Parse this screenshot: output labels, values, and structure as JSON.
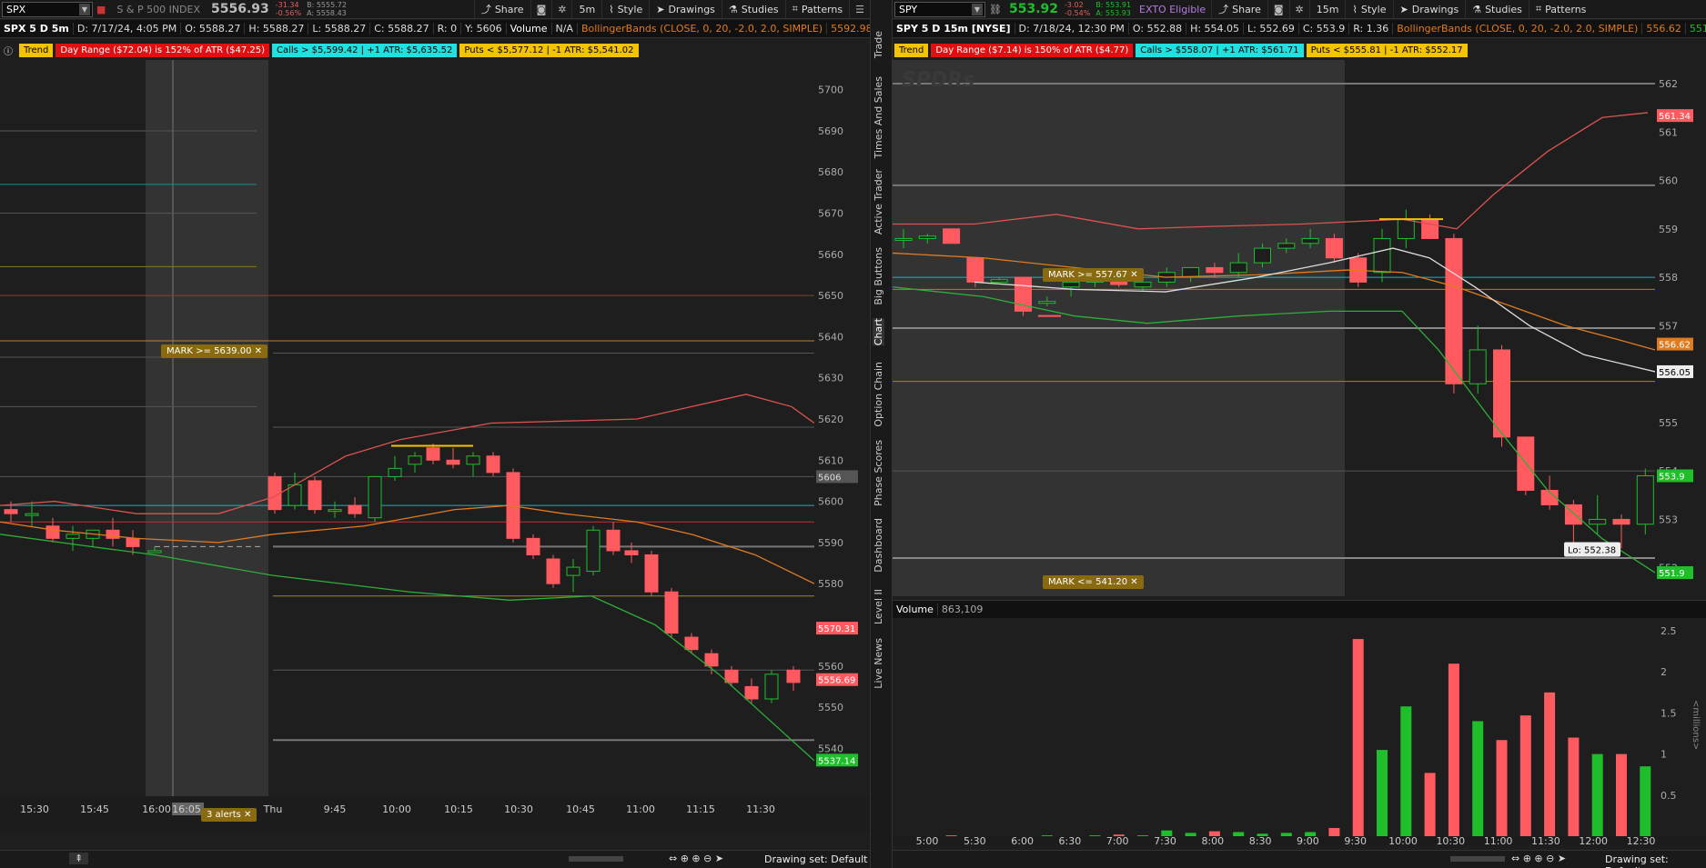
{
  "left": {
    "symbol": "SPX",
    "description": "S & P 500 INDEX",
    "price": "5556.93",
    "change": "-31.34",
    "change_pct": "-0.56%",
    "bid": "B: 5555.72",
    "ask": "A: 5558.43",
    "share_label": "Share",
    "timeframe": "5m",
    "style_label": "Style",
    "drawings_label": "Drawings",
    "studies_label": "Studies",
    "patterns_label": "Patterns",
    "chart_title": "SPX 5 D 5m",
    "info": [
      "D: 7/17/24, 4:05 PM",
      "O: 5588.27",
      "H: 5588.27",
      "L: 5588.27",
      "C: 5588.27",
      "R: 0",
      "Y: 5606"
    ],
    "volume_label": "Volume",
    "volume_value": "N/A",
    "bollinger": "BollingerBands (CLOSE, 0, 20, -2.0, 2.0, SIMPLE)",
    "bollinger_value": "5592.98",
    "chip_trend": "Trend",
    "chip_range": "Day Range ($72.04) is 152% of ATR ($47.25)",
    "chip_calls": "Calls > $5,599.42 | +1 ATR: $5,635.52",
    "chip_puts": "Puts < $5,577.12 | -1 ATR: $5,541.02",
    "mark_label": "MARK >= 5639.00",
    "alerts_label": "3 alerts",
    "price_labels": [
      "5700",
      "5690",
      "5680",
      "5670",
      "5660",
      "5650",
      "5640",
      "5630",
      "5620",
      "5610",
      "5600",
      "5590",
      "5580",
      "5560",
      "5550",
      "5540"
    ],
    "tag_5606": "5606",
    "tag_upper": "5570.31",
    "tag_price": "5556.69",
    "tag_lower": "5537.14",
    "time_labels": [
      "15:30",
      "15:45",
      "16:00",
      "16:05",
      "Thu",
      "9:45",
      "10:00",
      "10:15",
      "10:30",
      "10:45",
      "11:00",
      "11:15",
      "11:30"
    ],
    "drawing_set": "Drawing set: Default"
  },
  "right": {
    "symbol": "SPY",
    "price": "553.92",
    "change": "-3.02",
    "change_pct": "-0.54%",
    "bid": "B: 553.91",
    "ask": "A: 553.93",
    "exto": "EXTO Eligible",
    "share_label": "Share",
    "timeframe": "15m",
    "style_label": "Style",
    "drawings_label": "Drawings",
    "studies_label": "Studies",
    "patterns_label": "Patterns",
    "chart_title": "SPY 5 D 15m [NYSE]",
    "info": [
      "D: 7/18/24, 12:30 PM",
      "O: 552.88",
      "H: 554.05",
      "L: 552.69",
      "C: 553.9",
      "R: 1.36"
    ],
    "bollinger": "BollingerBands (CLOSE, 0, 20, -2.0, 2.0, SIMPLE)",
    "bollinger_value_1": "556.62",
    "bollinger_value_2": "551.9",
    "chip_trend": "Trend",
    "chip_range": "Day Range ($7.14) is 150% of ATR ($4.77)",
    "chip_calls": "Calls > $558.07 | +1 ATR: $561.71",
    "chip_puts": "Puts < $555.81 | -1 ATR: $552.17",
    "watermark": "SPDRs",
    "mark_upper": "MARK >= 557.67",
    "mark_lower": "MARK <= 541.20",
    "price_labels": [
      "562",
      "561",
      "560",
      "559",
      "558",
      "557",
      "556",
      "555",
      "554",
      "553",
      "552"
    ],
    "tag_upper": "561.34",
    "tag_mid": "556.62",
    "tag_sma": "556.05",
    "tag_price": "553.9",
    "tag_lower": "551.9",
    "low_label": "Lo: 552.38",
    "volume_label": "Volume",
    "volume_value": "863,109",
    "vol_axis": [
      "2.5",
      "2",
      "1.5",
      "1",
      "0.5"
    ],
    "vol_unit": "<millions>",
    "time_labels": [
      "5:00",
      "5:30",
      "6:00",
      "6:30",
      "7:00",
      "7:30",
      "8:00",
      "8:30",
      "9:00",
      "9:30",
      "10:00",
      "10:30",
      "11:00",
      "11:30",
      "12:00",
      "12:30"
    ],
    "drawing_set": "Drawing set: Default"
  },
  "side_tabs": [
    "Trade",
    "Times And Sales",
    "Active Trader",
    "Big Buttons",
    "Chart",
    "Option Chain",
    "Phase Scores",
    "Dashboard",
    "Level II",
    "Live News"
  ],
  "colors": {
    "up": "#1fbf2c",
    "down": "#ff5a5f",
    "upper_band": "#d9534f",
    "mid_band": "#e07b20",
    "lower_band": "#2fae3a",
    "sma": "#dddddd",
    "mark": "#8a6a10"
  },
  "chart_data": [
    {
      "type": "candlestick",
      "title": "SPX 5 D 5m",
      "ylim": [
        5535,
        5705
      ],
      "candles": [
        {
          "o": 5598,
          "h": 5600,
          "l": 5595,
          "c": 5597
        },
        {
          "o": 5597,
          "h": 5600,
          "l": 5594,
          "c": 5597
        },
        {
          "o": 5594,
          "h": 5596,
          "l": 5590,
          "c": 5591
        },
        {
          "o": 5591,
          "h": 5594,
          "l": 5588,
          "c": 5592
        },
        {
          "o": 5591,
          "h": 5593,
          "l": 5589,
          "c": 5593
        },
        {
          "o": 5593,
          "h": 5596,
          "l": 5589,
          "c": 5591
        },
        {
          "o": 5591,
          "h": 5593,
          "l": 5587,
          "c": 5589
        },
        {
          "o": 5588,
          "h": 5589,
          "l": 5588,
          "c": 5588
        },
        {
          "o": 5606,
          "h": 5607,
          "l": 5597,
          "c": 5598
        },
        {
          "o": 5599,
          "h": 5607,
          "l": 5598,
          "c": 5604
        },
        {
          "o": 5605,
          "h": 5606,
          "l": 5597,
          "c": 5598
        },
        {
          "o": 5598,
          "h": 5600,
          "l": 5596,
          "c": 5598
        },
        {
          "o": 5599,
          "h": 5601,
          "l": 5596,
          "c": 5597
        },
        {
          "o": 5596,
          "h": 5606,
          "l": 5595,
          "c": 5606
        },
        {
          "o": 5606,
          "h": 5611,
          "l": 5605,
          "c": 5608
        },
        {
          "o": 5609,
          "h": 5612,
          "l": 5607,
          "c": 5611
        },
        {
          "o": 5613,
          "h": 5614,
          "l": 5609,
          "c": 5610
        },
        {
          "o": 5610,
          "h": 5613,
          "l": 5608,
          "c": 5609
        },
        {
          "o": 5609,
          "h": 5612,
          "l": 5606,
          "c": 5611
        },
        {
          "o": 5611,
          "h": 5612,
          "l": 5606,
          "c": 5607
        },
        {
          "o": 5607,
          "h": 5608,
          "l": 5590,
          "c": 5591
        },
        {
          "o": 5591,
          "h": 5592,
          "l": 5586,
          "c": 5587
        },
        {
          "o": 5586,
          "h": 5587,
          "l": 5579,
          "c": 5580
        },
        {
          "o": 5582,
          "h": 5586,
          "l": 5578,
          "c": 5584
        },
        {
          "o": 5583,
          "h": 5594,
          "l": 5582,
          "c": 5593
        },
        {
          "o": 5593,
          "h": 5595,
          "l": 5587,
          "c": 5588
        },
        {
          "o": 5588,
          "h": 5590,
          "l": 5585,
          "c": 5587
        },
        {
          "o": 5587,
          "h": 5588,
          "l": 5577,
          "c": 5578
        },
        {
          "o": 5578,
          "h": 5579,
          "l": 5567,
          "c": 5568
        },
        {
          "o": 5567,
          "h": 5568,
          "l": 5563,
          "c": 5564
        },
        {
          "o": 5563,
          "h": 5564,
          "l": 5558,
          "c": 5560
        },
        {
          "o": 5559,
          "h": 5560,
          "l": 5555,
          "c": 5556
        },
        {
          "o": 5555,
          "h": 5557,
          "l": 5551,
          "c": 5552
        },
        {
          "o": 5552,
          "h": 5559,
          "l": 5551,
          "c": 5558
        },
        {
          "o": 5559,
          "h": 5560,
          "l": 5554,
          "c": 5556
        }
      ]
    },
    {
      "type": "candlestick",
      "title": "SPY 5 D 15m [NYSE]",
      "ylim": [
        551.6,
        562.3
      ],
      "candles": [
        {
          "o": 558.8,
          "h": 559,
          "l": 558.6,
          "c": 558.8
        },
        {
          "o": 558.8,
          "h": 558.9,
          "l": 558.7,
          "c": 558.85
        },
        {
          "o": 559,
          "h": 559,
          "l": 558.7,
          "c": 558.7
        },
        {
          "o": 558.4,
          "h": 558.4,
          "l": 557.8,
          "c": 557.9
        },
        {
          "o": 557.9,
          "h": 558,
          "l": 557.9,
          "c": 557.95
        },
        {
          "o": 558,
          "h": 558,
          "l": 557.2,
          "c": 557.3
        },
        {
          "o": 557.5,
          "h": 557.6,
          "l": 557.4,
          "c": 557.5
        },
        {
          "o": 557.8,
          "h": 557.9,
          "l": 557.6,
          "c": 557.9
        },
        {
          "o": 557.9,
          "h": 558,
          "l": 557.8,
          "c": 558
        },
        {
          "o": 557.9,
          "h": 558,
          "l": 557.8,
          "c": 557.85
        },
        {
          "o": 557.8,
          "h": 557.9,
          "l": 557.7,
          "c": 557.9
        },
        {
          "o": 557.9,
          "h": 558.2,
          "l": 557.8,
          "c": 558.1
        },
        {
          "o": 558,
          "h": 558.2,
          "l": 557.9,
          "c": 558.2
        },
        {
          "o": 558.2,
          "h": 558.3,
          "l": 558,
          "c": 558.1
        },
        {
          "o": 558.1,
          "h": 558.5,
          "l": 558,
          "c": 558.3
        },
        {
          "o": 558.3,
          "h": 558.7,
          "l": 558.2,
          "c": 558.6
        },
        {
          "o": 558.6,
          "h": 558.8,
          "l": 558.5,
          "c": 558.7
        },
        {
          "o": 558.7,
          "h": 559,
          "l": 558.6,
          "c": 558.8
        },
        {
          "o": 558.8,
          "h": 558.9,
          "l": 558.3,
          "c": 558.4
        },
        {
          "o": 558.4,
          "h": 558.5,
          "l": 557.8,
          "c": 557.9
        },
        {
          "o": 558.1,
          "h": 559,
          "l": 557.9,
          "c": 558.8
        },
        {
          "o": 558.8,
          "h": 559.4,
          "l": 558.6,
          "c": 559.2
        },
        {
          "o": 559.2,
          "h": 559.3,
          "l": 558.8,
          "c": 558.8
        },
        {
          "o": 558.8,
          "h": 558.9,
          "l": 555.6,
          "c": 555.8
        },
        {
          "o": 555.8,
          "h": 557,
          "l": 555.6,
          "c": 556.5
        },
        {
          "o": 556.5,
          "h": 556.6,
          "l": 554.5,
          "c": 554.7
        },
        {
          "o": 554.7,
          "h": 554.7,
          "l": 553.5,
          "c": 553.6
        },
        {
          "o": 553.6,
          "h": 553.9,
          "l": 553.2,
          "c": 553.3
        },
        {
          "o": 553.3,
          "h": 553.4,
          "l": 552.5,
          "c": 552.9
        },
        {
          "o": 552.9,
          "h": 553.5,
          "l": 552.7,
          "c": 553
        },
        {
          "o": 553,
          "h": 553.1,
          "l": 552.4,
          "c": 552.9
        },
        {
          "o": 552.9,
          "h": 554.05,
          "l": 552.69,
          "c": 553.9
        }
      ],
      "volume_millions": [
        0,
        0,
        0,
        0,
        0,
        0,
        0,
        0.01,
        0,
        0,
        0,
        0.01,
        0,
        0.01,
        0.02,
        0.01,
        0.07,
        0.04,
        0.06,
        0.05,
        0.03,
        0.04,
        0.05,
        0.1,
        2.4,
        1.05,
        1.58,
        0.77,
        2.1,
        1.4,
        1.17,
        1.47,
        1.75,
        1.2,
        1.0,
        1.0,
        0.85
      ]
    }
  ]
}
